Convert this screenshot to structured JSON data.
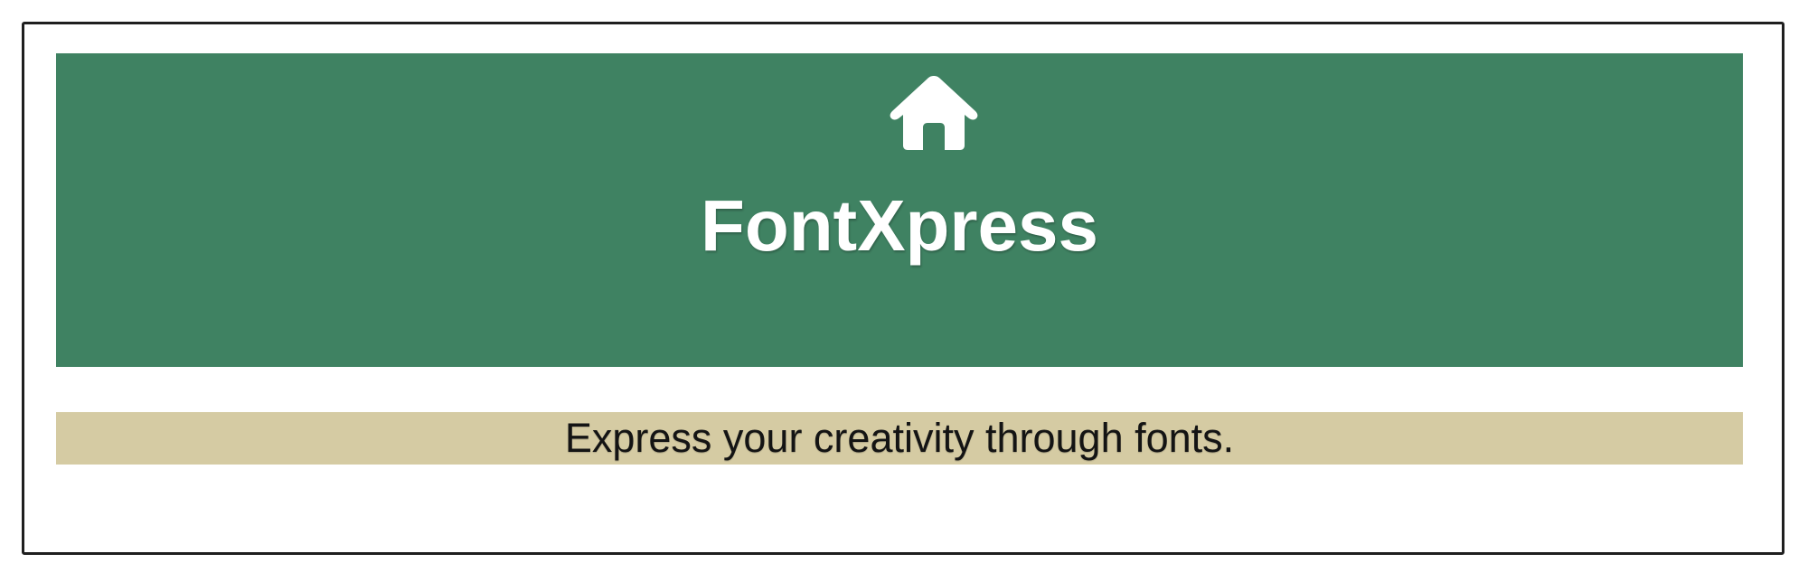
{
  "header": {
    "icon": "home-icon",
    "title": "FontXpress",
    "background_color": "#3f8262",
    "text_color": "#ffffff"
  },
  "tagline": {
    "text": "Express your creativity through fonts.",
    "background_color": "#d5cba3"
  }
}
